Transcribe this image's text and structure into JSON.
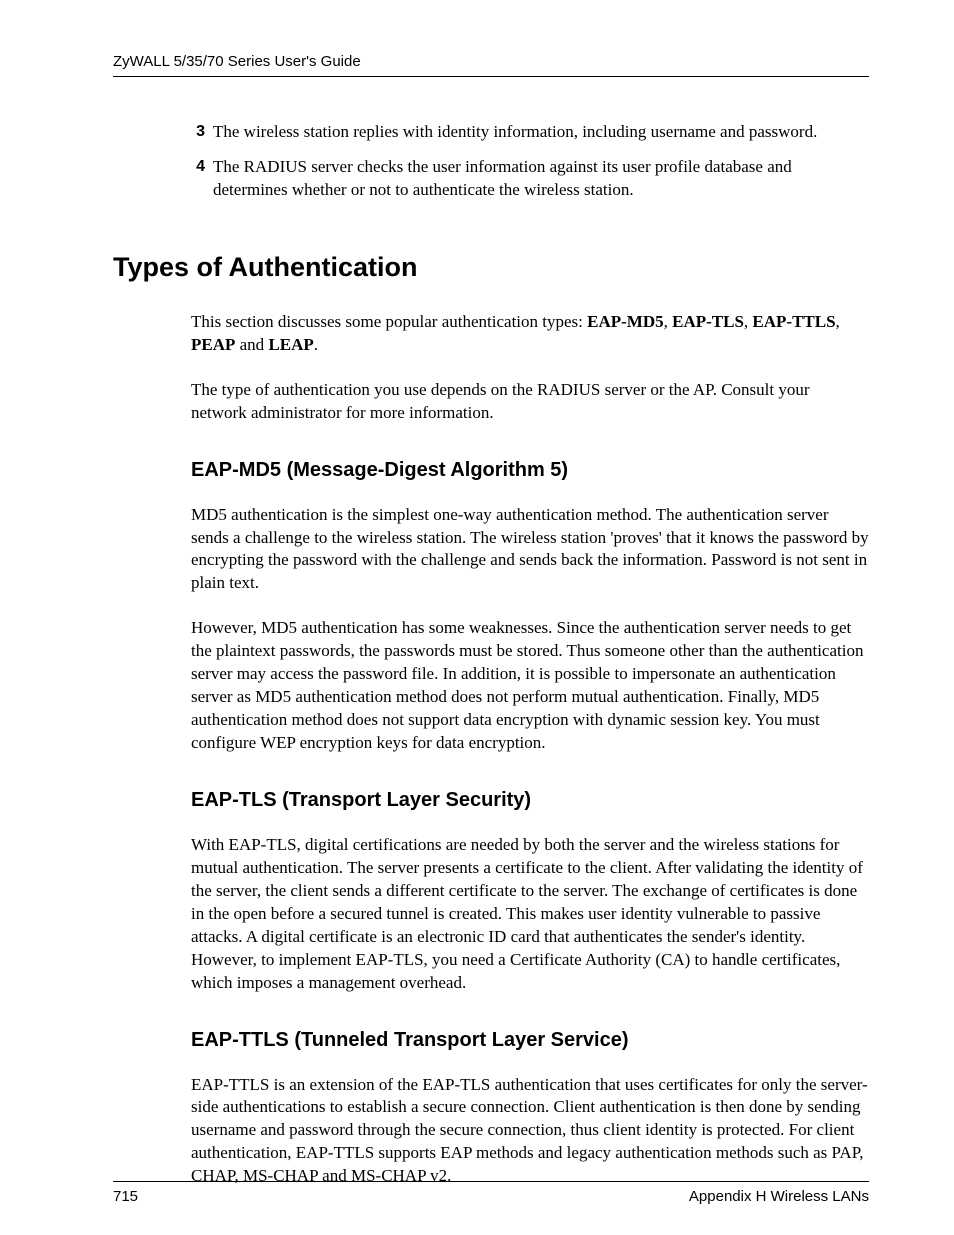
{
  "header": {
    "guide_title": "ZyWALL 5/35/70 Series User's Guide"
  },
  "list": {
    "item3": {
      "num": "3",
      "text": "The wireless station replies with identity information, including username and password."
    },
    "item4": {
      "num": "4",
      "text": "The RADIUS server checks the user information against its user profile database and determines whether or not to authenticate the wireless station."
    }
  },
  "section": {
    "title": "Types of  Authentication",
    "intro": {
      "prefix": "This section discusses some popular authentication types: ",
      "b1": "EAP-MD5",
      "sep1": ", ",
      "b2": "EAP-TLS",
      "sep2": ", ",
      "b3": "EAP-TTLS",
      "sep3": ", ",
      "b4": "PEAP",
      "sep4": " and ",
      "b5": "LEAP",
      "suffix": "."
    },
    "intro2": "The type of authentication you use depends on the RADIUS server or the AP. Consult your network administrator for more information.",
    "md5": {
      "title": "EAP-MD5 (Message-Digest Algorithm 5)",
      "p1": "MD5 authentication is the simplest one-way authentication method. The authentication server sends a challenge to the wireless station. The wireless station 'proves' that it knows the password by encrypting the password with the challenge and sends back the information. Password is not sent in plain text.",
      "p2": "However, MD5 authentication has some weaknesses. Since the authentication server needs to get the plaintext passwords, the passwords must be stored. Thus someone other than the authentication server may access the password file. In addition, it is possible to impersonate an authentication server as MD5 authentication method does not perform mutual authentication. Finally, MD5 authentication method does not support data encryption with dynamic session key. You must configure WEP encryption keys for data encryption."
    },
    "tls": {
      "title": "EAP-TLS (Transport Layer Security)",
      "p1": "With EAP-TLS, digital certifications are needed by both the server and the wireless stations for mutual authentication. The server presents a certificate to the client. After validating the identity of the server, the client sends a different certificate to the server. The exchange of certificates is done in the open before a secured tunnel is created. This makes user identity vulnerable to passive attacks. A digital certificate is an electronic ID card that authenticates the sender's identity. However, to implement EAP-TLS, you need a Certificate Authority (CA) to handle certificates, which imposes a management overhead."
    },
    "ttls": {
      "title": "EAP-TTLS (Tunneled Transport Layer Service)",
      "p1": "EAP-TTLS is an extension of the EAP-TLS authentication that uses certificates for only the server-side authentications to establish a secure connection. Client authentication is then done by sending username and password through the secure connection, thus client identity is protected. For client authentication, EAP-TTLS supports EAP methods and legacy authentication methods such as PAP, CHAP, MS-CHAP and MS-CHAP v2."
    }
  },
  "footer": {
    "page": "715",
    "appendix": "Appendix H Wireless LANs"
  }
}
